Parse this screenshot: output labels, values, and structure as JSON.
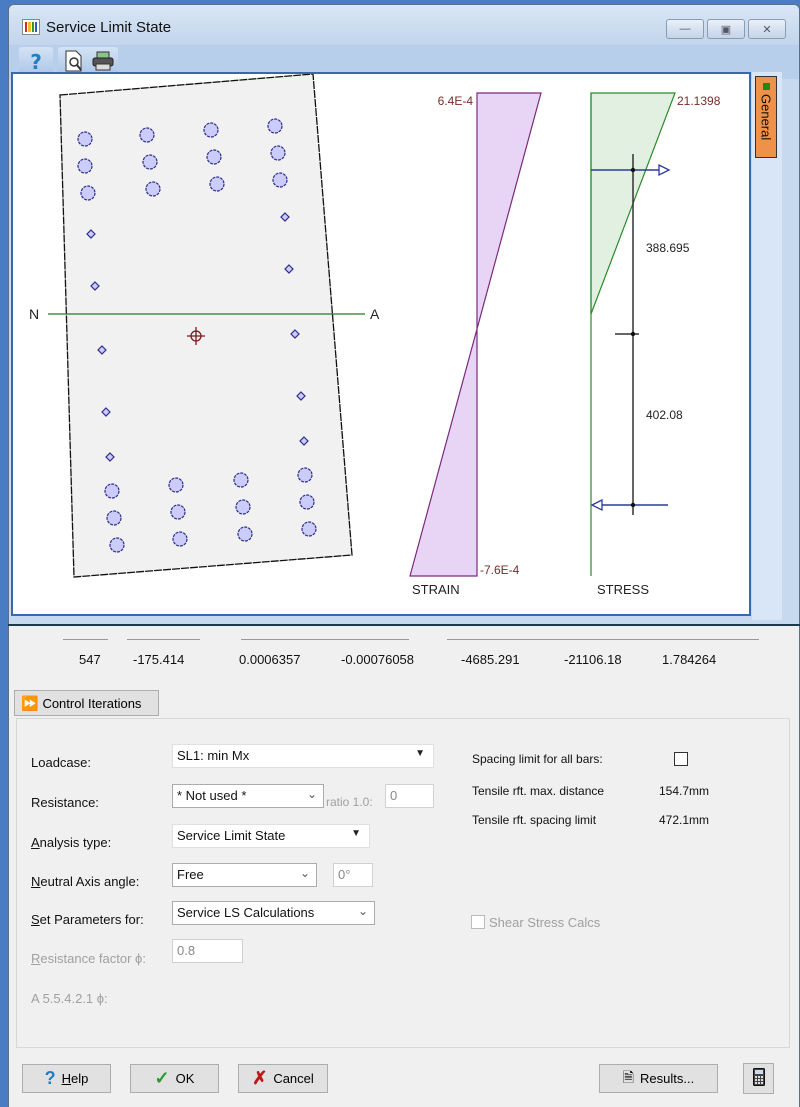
{
  "window": {
    "title": "Service Limit State",
    "controls": {
      "minimize": "—",
      "maximize": "▣",
      "close": "✕"
    }
  },
  "toolbar": {
    "help_icon": "question-icon",
    "preview_icon": "print-preview-icon",
    "print_icon": "printer-icon"
  },
  "side_tabs": [
    {
      "label": "General",
      "indicator_color": "#1a8a1a"
    }
  ],
  "diagram": {
    "axis_labels": {
      "left": "N",
      "right": "A"
    },
    "strain": {
      "title": "STRAIN",
      "top_value": "6.4E-4",
      "bottom_value": "-7.6E-4"
    },
    "stress": {
      "title": "STRESS",
      "top_value": "21.1398",
      "lever_upper": "388.695",
      "lever_lower": "402.08"
    },
    "colors": {
      "strain_fill": "#e8d4f5",
      "strain_stroke": "#7a2a7a",
      "stress_fill": "#e2f0e2",
      "stress_stroke": "#2a8a2a",
      "axis": "#2a7a2a",
      "bars": "#ccccfa",
      "bar_stroke": "#2c2c8c",
      "value_text": "#7a2a2a",
      "force_arrow": "#2a3a9a"
    }
  },
  "summary_values": [
    "547",
    "-175.414",
    "0.0006357",
    "-0.00076058",
    "-4685.291",
    "-21106.18",
    "1.784264"
  ],
  "control_iterations_label": "Control Iterations",
  "form": {
    "loadcase": {
      "label": "Loadcase:",
      "value": "SL1: min Mx"
    },
    "resistance": {
      "label": "Resistance:",
      "value": "* Not used *",
      "ratio_label": "ratio 1.0:",
      "ratio_value": "0"
    },
    "analysis_type": {
      "label_u": "A",
      "label_rest": "nalysis type:",
      "value": "Service Limit State"
    },
    "neutral_axis": {
      "label_u": "N",
      "label_rest": "eutral Axis angle:",
      "value": "Free",
      "angle": "0°"
    },
    "set_params": {
      "label_u": "S",
      "label_rest": "et Parameters for:",
      "value": "Service LS Calculations"
    },
    "resistance_factor": {
      "label_u": "R",
      "label_rest": "esistance factor ϕ:",
      "value": "0.8"
    },
    "a5542": {
      "label": "A 5.5.4.2.1 ϕ:"
    },
    "spacing_limit": {
      "label": "Spacing limit for all bars:",
      "checked": false
    },
    "tensile_max_distance": {
      "label": "Tensile rft. max. distance",
      "value": "154.7mm"
    },
    "tensile_spacing_limit": {
      "label": "Tensile rft. spacing limit",
      "value": "472.1mm"
    },
    "shear_stress": {
      "label": "Shear Stress Calcs",
      "checked": false,
      "enabled": false
    }
  },
  "buttons": {
    "help": {
      "label_u": "H",
      "label_rest": "elp"
    },
    "ok": "OK",
    "cancel": "Cancel",
    "results": "Results...",
    "calculator_icon": "calculator-icon"
  }
}
